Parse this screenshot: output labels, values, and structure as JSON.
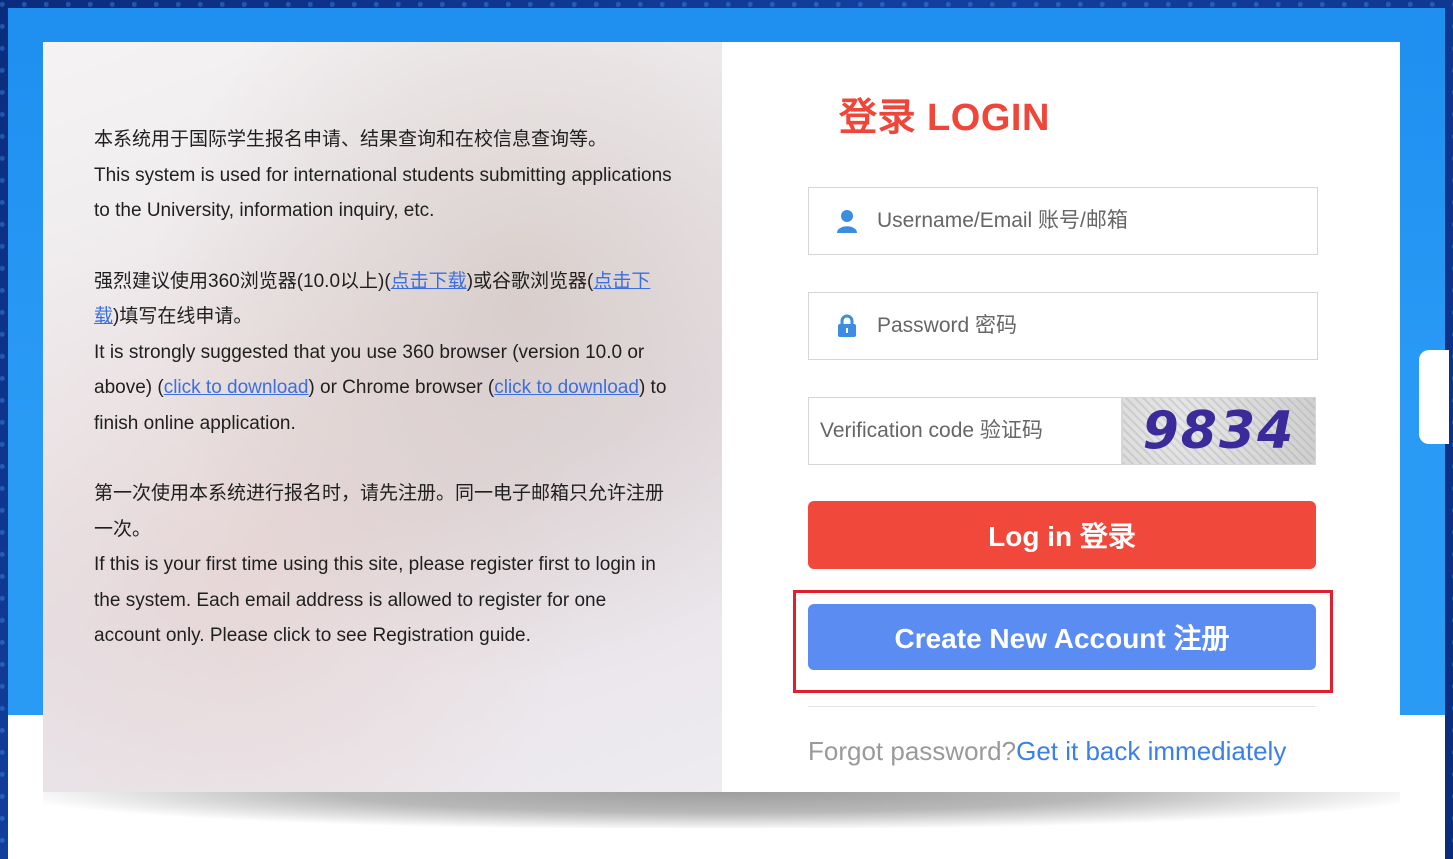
{
  "intro": {
    "p1_cn": "本系统用于国际学生报名申请、结果查询和在校信息查询等。",
    "p1_en": "This system is used for international students submitting applications to the University, information inquiry, etc.",
    "p2_cn_before": "强烈建议使用360浏览器(10.0以上)(",
    "p2_cn_link1": "点击下载",
    "p2_cn_middle": ")或谷歌浏览器(",
    "p2_cn_link2": "点击下载",
    "p2_cn_after": ")填写在线申请。",
    "p2_en_before": "It is strongly suggested that you use 360 browser (version 10.0 or above) (",
    "p2_en_link1": "click to download",
    "p2_en_middle": ") or Chrome browser (",
    "p2_en_link2": "click to download",
    "p2_en_after": ") to finish online application.",
    "p3_cn": "第一次使用本系统进行报名时，请先注册。同一电子邮箱只允许注册一次。",
    "p3_en": "If this is your first time using this site, please register first to login in the system. Each email address is allowed to register for one account only. Please click to see Registration guide."
  },
  "login": {
    "title": "登录 LOGIN",
    "username_placeholder": "Username/Email 账号/邮箱",
    "password_placeholder": "Password 密码",
    "code_placeholder": "Verification code 验证码",
    "captcha_text": "9834",
    "login_button": "Log in 登录",
    "create_button": "Create New Account 注册",
    "forgot_text": "Forgot password?",
    "forgot_link": "Get it back immediately"
  },
  "colors": {
    "accent_red": "#f0483b",
    "accent_blue": "#5b8cf1",
    "highlight_box": "#e0202e",
    "link": "#3b6fe0"
  },
  "icons": {
    "username": "user-icon",
    "password": "lock-icon"
  }
}
